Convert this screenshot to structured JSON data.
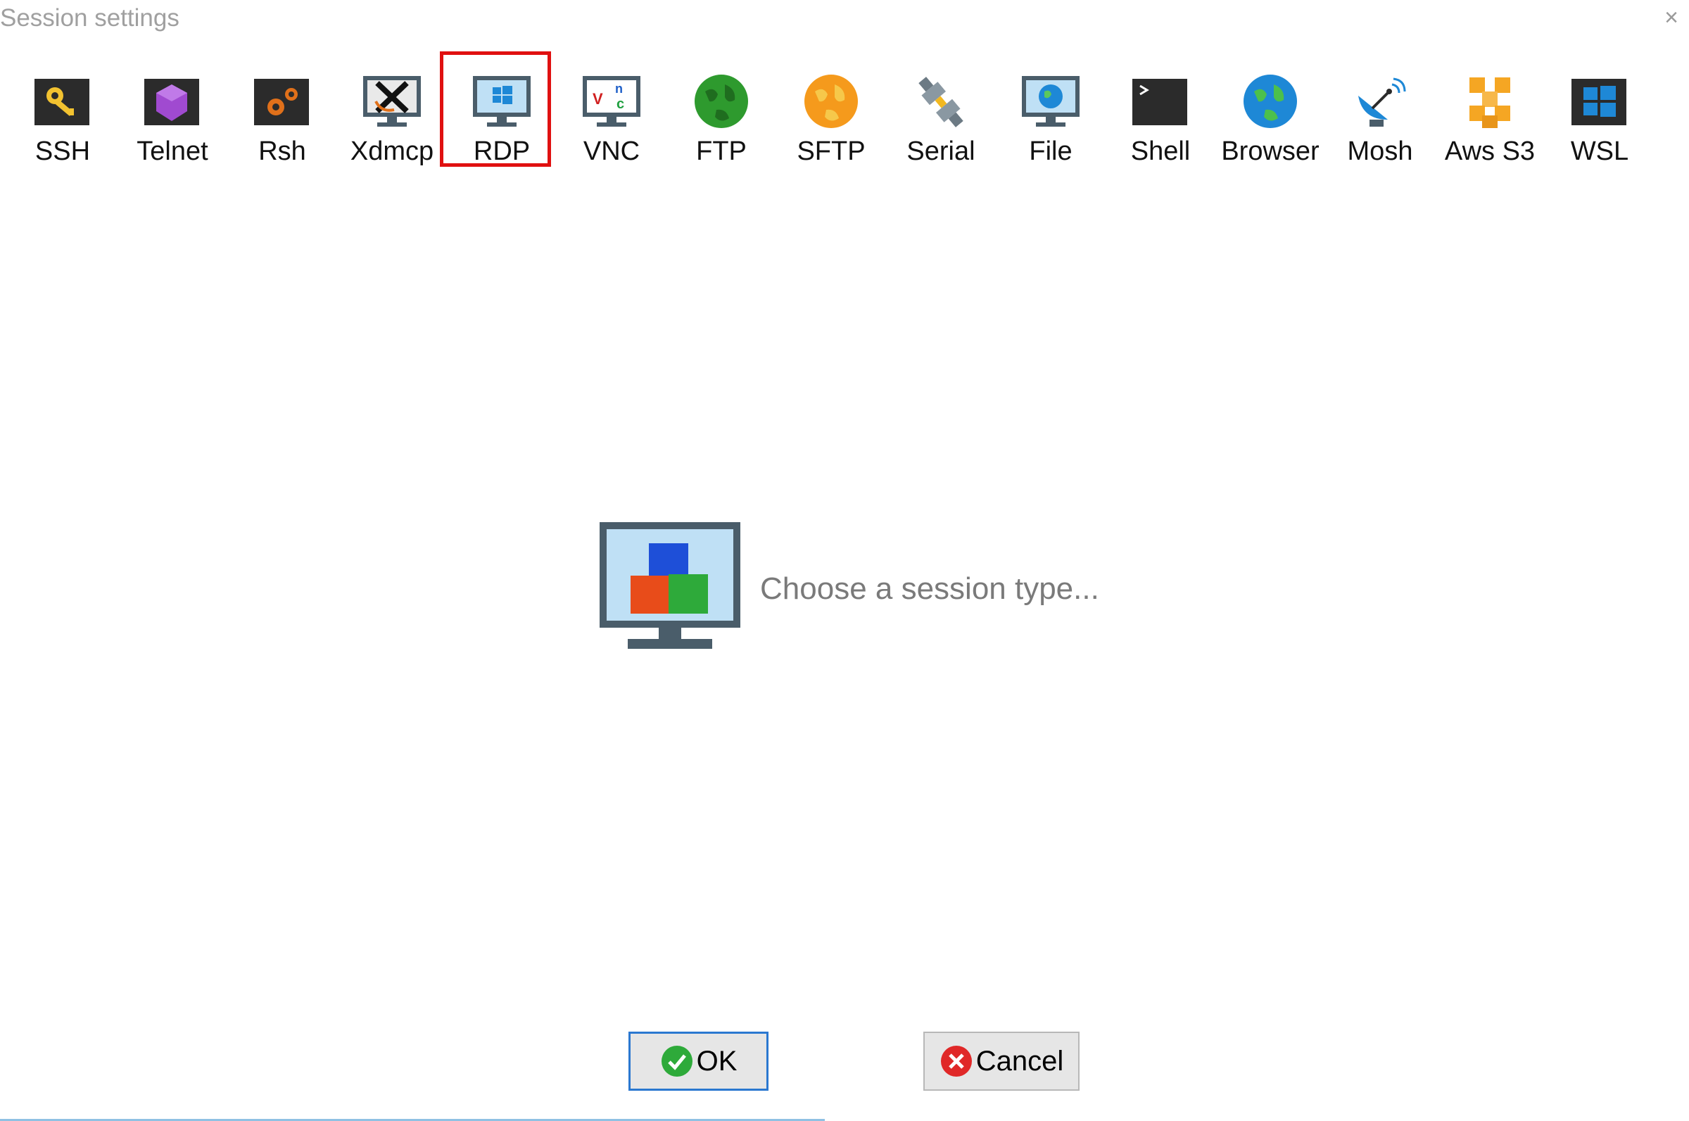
{
  "window": {
    "title": "Session settings",
    "close_glyph": "×"
  },
  "toolbar": {
    "items": [
      {
        "label": "SSH",
        "icon": "key-icon"
      },
      {
        "label": "Telnet",
        "icon": "gem-icon"
      },
      {
        "label": "Rsh",
        "icon": "gears-icon"
      },
      {
        "label": "Xdmcp",
        "icon": "x-monitor-icon"
      },
      {
        "label": "RDP",
        "icon": "windows-monitor-icon"
      },
      {
        "label": "VNC",
        "icon": "vnc-monitor-icon"
      },
      {
        "label": "FTP",
        "icon": "green-globe-icon"
      },
      {
        "label": "SFTP",
        "icon": "orange-globe-icon"
      },
      {
        "label": "Serial",
        "icon": "plug-icon"
      },
      {
        "label": "File",
        "icon": "globe-monitor-icon"
      },
      {
        "label": "Shell",
        "icon": "terminal-icon"
      },
      {
        "label": "Browser",
        "icon": "blue-globe-icon"
      },
      {
        "label": "Mosh",
        "icon": "satellite-dish-icon"
      },
      {
        "label": "Aws S3",
        "icon": "aws-cubes-icon"
      },
      {
        "label": "WSL",
        "icon": "windows-tile-icon"
      }
    ]
  },
  "main": {
    "message": "Choose a session type...",
    "icon": "cubes-monitor-icon"
  },
  "buttons": {
    "ok_label": "OK",
    "cancel_label": "Cancel"
  },
  "colors": {
    "highlight": "#e01010",
    "ok_border": "#2b78d0",
    "title_text": "#a0a0a0"
  }
}
